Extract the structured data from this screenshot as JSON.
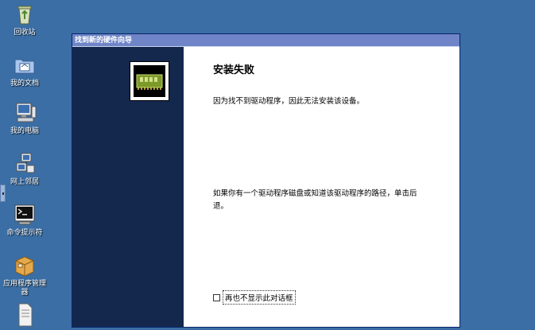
{
  "desktop": {
    "icons": [
      {
        "label": "回收站",
        "icon": "recycle-bin-icon"
      },
      {
        "label": "我的文档",
        "icon": "folder-documents-icon"
      },
      {
        "label": "我的电脑",
        "icon": "computer-icon"
      },
      {
        "label": "网上邻居",
        "icon": "network-icon"
      },
      {
        "label": "命令提示符",
        "icon": "terminal-icon"
      },
      {
        "label": "应用程序管理器",
        "icon": "package-icon"
      },
      {
        "label": "",
        "icon": "document-icon"
      }
    ]
  },
  "wizard": {
    "title": "找到新的硬件向导",
    "heading": "安装失败",
    "message_1": "因为找不到驱动程序，因此无法安装该设备。",
    "message_2": "如果你有一个驱动程序磁盘或知道该驱动程序的路径，单击后退。",
    "checkbox_label": "再也不显示此对话框",
    "checkbox_checked": false,
    "hardware_icon": "circuit-board-icon"
  },
  "colors": {
    "desktop_bg": "#3a6ea5",
    "titlebar": "#6f85c7",
    "left_panel": "#14284e"
  }
}
